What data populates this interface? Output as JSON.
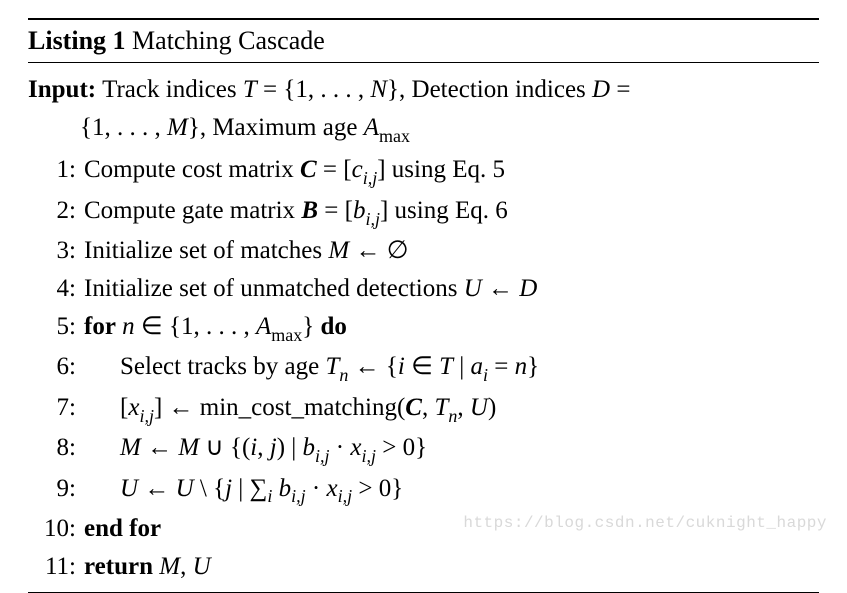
{
  "listing": {
    "label": "Listing 1",
    "title": "Matching Cascade"
  },
  "input": {
    "label": "Input:",
    "line1_a": "Track indices ",
    "line1_T": "T",
    "line1_b": " = {1, . . . , ",
    "line1_N": "N",
    "line1_c": "}, Detection indices ",
    "line1_D": "D",
    "line1_d": " =",
    "line2_a": "{1, . . . , ",
    "line2_M": "M",
    "line2_b": "}, Maximum age ",
    "line2_Amax_A": "A",
    "line2_Amax_max": "max"
  },
  "steps": {
    "s1": {
      "num": "1:",
      "a": "Compute cost matrix ",
      "C": "C",
      "b": " = [",
      "c_var": "c",
      "ij": "i,j",
      "d": "] using Eq. 5"
    },
    "s2": {
      "num": "2:",
      "a": "Compute gate matrix ",
      "B": "B",
      "b": " = [",
      "b_var": "b",
      "ij": "i,j",
      "d": "] using Eq. 6"
    },
    "s3": {
      "num": "3:",
      "a": "Initialize set of matches ",
      "M": "M",
      "b": " ← ∅"
    },
    "s4": {
      "num": "4:",
      "a": "Initialize set of unmatched detections ",
      "U": "U",
      "b": " ← ",
      "D": "D"
    },
    "s5": {
      "num": "5:",
      "for": "for",
      "a": " ",
      "n": "n",
      "b": " ∈ {1, . . . , ",
      "Amax_A": "A",
      "Amax_max": "max",
      "c": "} ",
      "do": "do"
    },
    "s6": {
      "num": "6:",
      "a": "Select tracks by age ",
      "Tn_T": "T",
      "Tn_n": "n",
      "b": " ← {",
      "i": "i",
      "c": " ∈ ",
      "T": "T",
      "d": " | ",
      "ai_a": "a",
      "ai_i": "i",
      "e": " = ",
      "n2": "n",
      "f": "}"
    },
    "s7": {
      "num": "7:",
      "a": "[",
      "x": "x",
      "ij": "i,j",
      "b": "] ← min_cost_matching(",
      "C": "C",
      "c": ", ",
      "Tn_T": "T",
      "Tn_n": "n",
      "d": ", ",
      "U": "U",
      "e": ")"
    },
    "s8": {
      "num": "8:",
      "M1": "M",
      "a": " ← ",
      "M2": "M",
      "b": " ∪ {(",
      "i": "i",
      "c": ", ",
      "j": "j",
      "d": ") | ",
      "bv": "b",
      "ij1": "i,j",
      "e": " · ",
      "xv": "x",
      "ij2": "i,j",
      "f": " > 0}"
    },
    "s9": {
      "num": "9:",
      "U1": "U",
      "a": " ← ",
      "U2": "U",
      "b": " \\ {",
      "j": "j",
      "c": " | ∑",
      "sum_i": "i",
      "d": " ",
      "bv": "b",
      "ij1": "i,j",
      "e": " · ",
      "xv": "x",
      "ij2": "i,j",
      "f": " > 0}"
    },
    "s10": {
      "num": "10:",
      "endfor": "end for"
    },
    "s11": {
      "num": "11:",
      "return": "return",
      "sp": "  ",
      "M": "M",
      "c": ", ",
      "U": "U"
    }
  },
  "watermark": "https://blog.csdn.net/cuknight_happy"
}
